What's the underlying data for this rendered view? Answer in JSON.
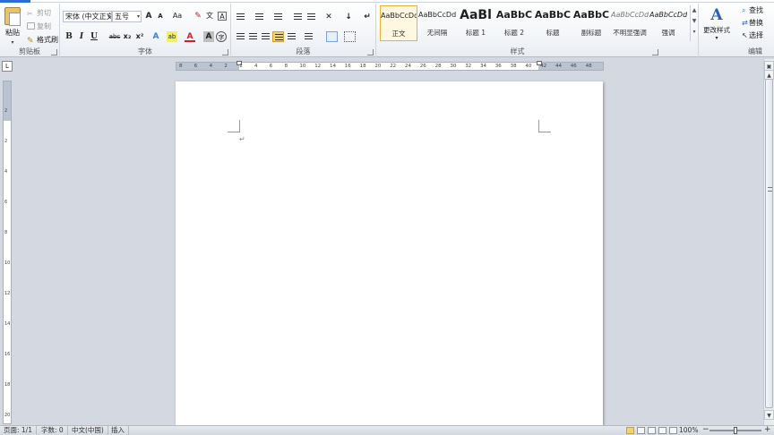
{
  "ribbon": {
    "clipboard": {
      "paste": "粘贴",
      "cut": "剪切",
      "copy": "复制",
      "format_painter": "格式刷",
      "group_label": "剪贴板"
    },
    "font": {
      "font_name": "宋体 (中文正文)",
      "font_size": "五号",
      "grow_font": "A",
      "shrink_font": "A",
      "change_case": "Aa",
      "clear_format": "✎",
      "phonetic": "文",
      "char_border": "A",
      "bold": "B",
      "italic": "I",
      "underline": "U",
      "strikethrough": "abc",
      "subscript": "x₂",
      "superscript": "x²",
      "text_effects": "A",
      "highlight": "ab",
      "font_color": "A",
      "char_shading": "A",
      "enclose": "字",
      "group_label": "字体"
    },
    "paragraph": {
      "group_label": "段落",
      "asian_layout": "✕",
      "sort": "↓",
      "show_marks": "↵"
    },
    "styles": {
      "group_label": "样式",
      "items": [
        {
          "sample": "AaBbCcDd",
          "name": "正文",
          "selected": true
        },
        {
          "sample": "AaBbCcDd",
          "name": "无间隔"
        },
        {
          "sample": "AaBl",
          "name": "标题 1"
        },
        {
          "sample": "AaBbC",
          "name": "标题 2"
        },
        {
          "sample": "AaBbC",
          "name": "标题"
        },
        {
          "sample": "AaBbC",
          "name": "副标题"
        },
        {
          "sample": "AaBbCcDd",
          "name": "不明显强调"
        },
        {
          "sample": "AaBbCcDd",
          "name": "强调"
        }
      ],
      "change_styles": "更改样式",
      "change_styles_glyph": "A"
    },
    "editing": {
      "find": "查找",
      "replace": "替换",
      "select": "选择",
      "group_label": "编辑"
    }
  },
  "ruler": {
    "corner": "L",
    "h_numbers": [
      "8",
      "6",
      "4",
      "2",
      "2",
      "4",
      "6",
      "8",
      "10",
      "12",
      "14",
      "16",
      "18",
      "20",
      "22",
      "24",
      "26",
      "28",
      "30",
      "32",
      "34",
      "36",
      "38",
      "40",
      "42",
      "44",
      "46",
      "48"
    ],
    "v_numbers": [
      "2",
      "2",
      "4",
      "6",
      "8",
      "10",
      "12",
      "14",
      "16",
      "18",
      "20"
    ]
  },
  "document": {
    "paragraph_mark": "↵"
  },
  "status": {
    "page": "页面: 1/1",
    "words": "字数: 0",
    "language": "中文(中国)",
    "insert_mode": "插入",
    "zoom": "100%"
  }
}
